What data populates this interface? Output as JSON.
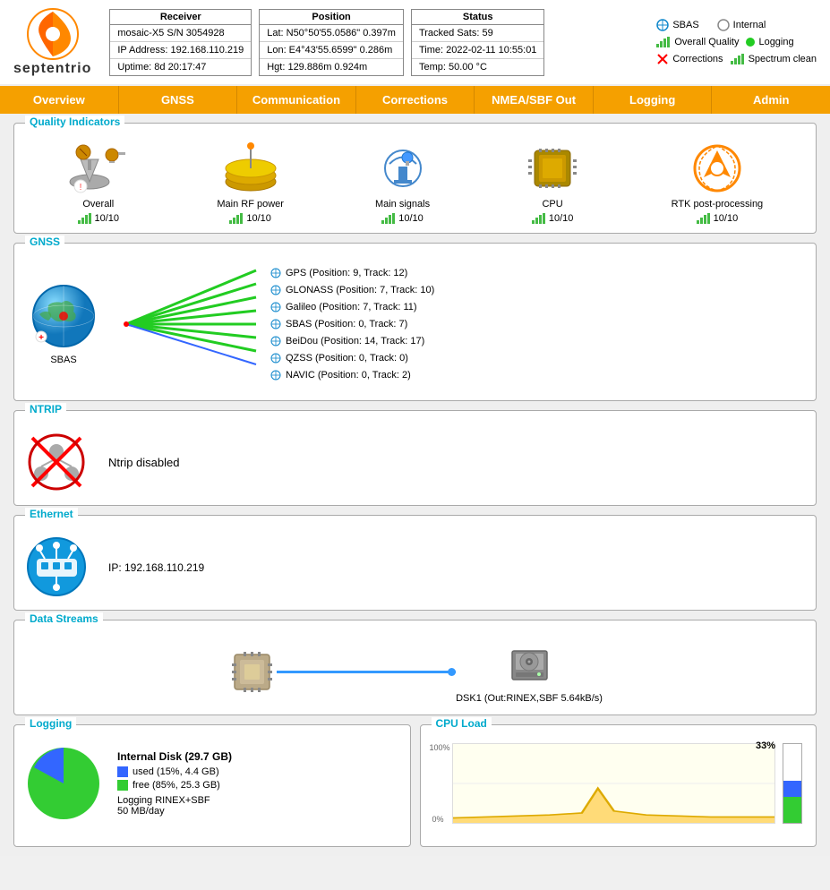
{
  "header": {
    "logo_text": "septentrio",
    "receiver": {
      "title": "Receiver",
      "row1": "mosaic-X5 S/N 3054928",
      "row2": "IP Address: 192.168.110.219",
      "row3": "Uptime: 8d 20:17:47"
    },
    "position": {
      "title": "Position",
      "row1": "Lat: N50°50'55.0586\"  0.397m",
      "row2": "Lon: E4°43'55.6599\"  0.286m",
      "row3": "Hgt: 129.886m  0.924m"
    },
    "status": {
      "title": "Status",
      "row1": "Tracked Sats: 59",
      "row2": "Time: 2022-02-11 10:55:01",
      "row3": "Temp: 50.00 °C"
    },
    "indicators": {
      "sbas": "SBAS",
      "overall_quality": "Overall Quality",
      "corrections": "Corrections",
      "internal": "Internal",
      "logging": "Logging",
      "spectrum_clean": "Spectrum clean"
    }
  },
  "navbar": {
    "items": [
      "Overview",
      "GNSS",
      "Communication",
      "Corrections",
      "NMEA/SBF Out",
      "Logging",
      "Admin"
    ]
  },
  "quality": {
    "title": "Quality Indicators",
    "items": [
      {
        "label": "Overall",
        "score": "10/10"
      },
      {
        "label": "Main RF power",
        "score": "10/10"
      },
      {
        "label": "Main signals",
        "score": "10/10"
      },
      {
        "label": "CPU",
        "score": "10/10"
      },
      {
        "label": "RTK post-processing",
        "score": "10/10"
      }
    ]
  },
  "gnss": {
    "title": "GNSS",
    "globe_label": "SBAS",
    "satellites": [
      "GPS (Position: 9, Track: 12)",
      "GLONASS (Position: 7, Track: 10)",
      "Galileo (Position: 7, Track: 11)",
      "SBAS (Position: 0, Track: 7)",
      "BeiDou (Position: 14, Track: 17)",
      "QZSS (Position: 0, Track: 0)",
      "NAVIC (Position: 0, Track: 2)"
    ]
  },
  "ntrip": {
    "title": "NTRIP",
    "status": "Ntrip disabled"
  },
  "ethernet": {
    "title": "Ethernet",
    "ip": "IP: 192.168.110.219"
  },
  "data_streams": {
    "title": "Data Streams",
    "destination": "DSK1 (Out:RINEX,SBF 5.64kB/s)"
  },
  "logging": {
    "title": "Logging",
    "disk_title": "Internal Disk (29.7 GB)",
    "used_label": "used (15%, 4.4 GB)",
    "free_label": "free (85%, 25.3 GB)",
    "rate": "Logging RINEX+SBF",
    "rate2": "50 MB/day",
    "used_pct": 15,
    "free_pct": 85
  },
  "cpu": {
    "title": "CPU Load",
    "percentage": "33%",
    "max_label": "100%",
    "min_label": "0%",
    "used_bar_pct": 33,
    "blue_bar_pct": 20
  }
}
